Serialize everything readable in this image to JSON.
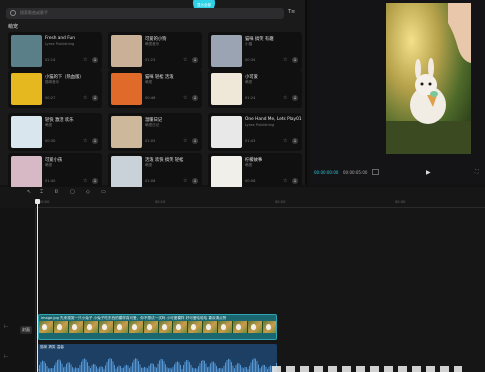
{
  "music_panel": {
    "search_placeholder": "搜索歌曲或歌手",
    "sort_label": "T≡",
    "top_pill": "显示全部",
    "section_title": "萌宠",
    "cards": [
      {
        "title": "Fresh and Fun",
        "sub": "Lyrae Publishing",
        "dur": "02:14",
        "thumb": "#5a7f88"
      },
      {
        "title": "可爱的小狗",
        "sub": "萌宠音乐",
        "dur": "01:23",
        "thumb": "#c9b096"
      },
      {
        "title": "猫咪 搞笑 有趣",
        "sub": "小猫",
        "dur": "00:34",
        "thumb": "#9aa4b3"
      },
      {
        "title": "小猫的下（热血版）",
        "sub": "猫咪音乐",
        "dur": "00:27",
        "thumb": "#e6b81f"
      },
      {
        "title": "猫咪 轻松 活泼",
        "sub": "萌宠",
        "dur": "00:46",
        "thumb": "#e06a2a"
      },
      {
        "title": "小可爱",
        "sub": "萌宠",
        "dur": "01:24",
        "thumb": "#efe8d8"
      },
      {
        "title": "轻快 激活 欢乐",
        "sub": "萌宠",
        "dur": "00:30",
        "thumb": "#d9e6ee"
      },
      {
        "title": "温暖日记",
        "sub": "萌宠日记",
        "dur": "01:05",
        "thumb": "#cdb89c"
      },
      {
        "title": "One Hand Me, Lets Play01",
        "sub": "Lyrae Publishing",
        "dur": "01:43",
        "thumb": "#e8e8e8"
      },
      {
        "title": "可爱小孩",
        "sub": "萌宠",
        "dur": "01:40",
        "thumb": "#d7b9c6"
      },
      {
        "title": "活泼 欢快 搞笑 轻松",
        "sub": "萌宠",
        "dur": "01:08",
        "thumb": "#c9d2d8"
      },
      {
        "title": "柠檬故事",
        "sub": "萌宠",
        "dur": "00:58",
        "thumb": "#f1efe9"
      }
    ]
  },
  "player": {
    "timecode_current": "00:00:00:00",
    "timecode_total": "00:00:05:00"
  },
  "timeline": {
    "ticks": [
      "00:00",
      "00:10",
      "00:20",
      "00:30"
    ],
    "cover_label": "封面",
    "video_clip_name": "image.jpg 先来观赏一只小兔子 小兔子吃东西的模样真可爱，你不想试一试吗 小可爱模样 好可爱哈哈哈 喜欢请点赞",
    "audio_clip_name": "猫咪 搞笑 温馨"
  }
}
